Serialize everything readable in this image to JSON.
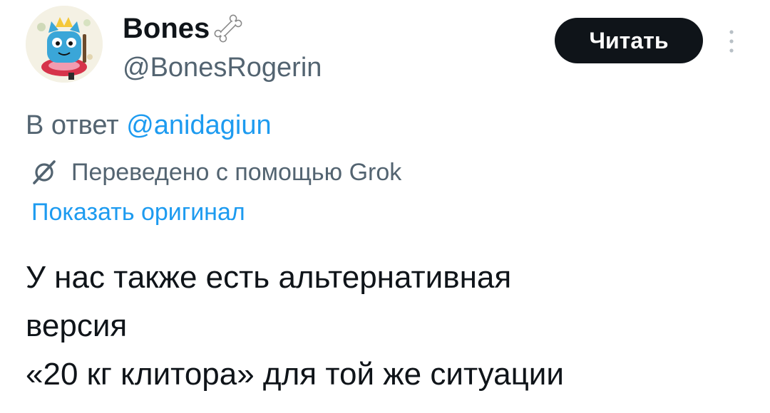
{
  "author": {
    "display_name": "Bones",
    "handle": "@BonesRogerin",
    "avatar_icon": "cartoon-cat-avatar",
    "name_emoji_icon": "bone-icon"
  },
  "follow_button": {
    "label": "Читать"
  },
  "more_menu_icon": "vertical-ellipsis-icon",
  "reply": {
    "prefix": "В ответ ",
    "mention": "@anidagiun"
  },
  "translation": {
    "icon": "grok-icon",
    "label": "Переведено с помощью Grok",
    "show_original": "Показать оригинал"
  },
  "tweet": {
    "lines": [
      "У нас также есть альтернативная",
      "версия",
      "«20 кг клитора» для той же ситуации"
    ]
  },
  "colors": {
    "text_primary": "#0f1419",
    "text_secondary": "#536471",
    "link": "#1d9bf0",
    "button_bg": "#0f1419",
    "button_text": "#ffffff"
  }
}
